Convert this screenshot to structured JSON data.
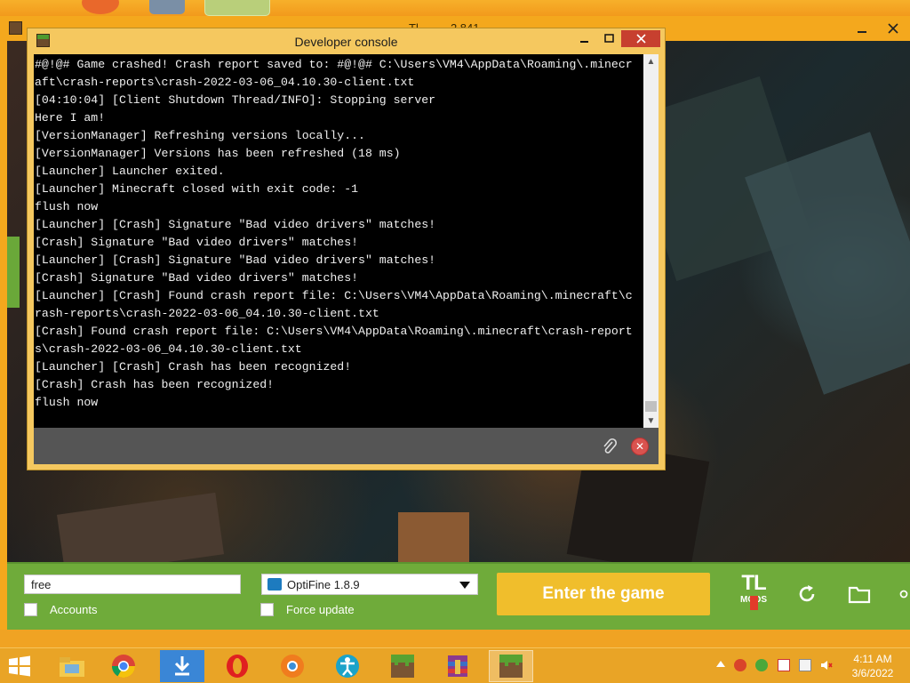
{
  "background_window": {
    "title": "Tl..........2.841"
  },
  "console": {
    "title": "Developer console",
    "lines": [
      "#@!@# Game crashed! Crash report saved to: #@!@# C:\\Users\\VM4\\AppData\\Roaming\\.minecr",
      "aft\\crash-reports\\crash-2022-03-06_04.10.30-client.txt",
      "[04:10:04] [Client Shutdown Thread/INFO]: Stopping server",
      "Here I am!",
      "[VersionManager] Refreshing versions locally...",
      "[VersionManager] Versions has been refreshed (18 ms)",
      "[Launcher] Launcher exited.",
      "[Launcher] Minecraft closed with exit code: -1",
      "flush now",
      "[Launcher] [Crash] Signature \"Bad video drivers\" matches!",
      "[Crash] Signature \"Bad video drivers\" matches!",
      "[Launcher] [Crash] Signature \"Bad video drivers\" matches!",
      "[Crash] Signature \"Bad video drivers\" matches!",
      "[Launcher] [Crash] Found crash report file: C:\\Users\\VM4\\AppData\\Roaming\\.minecraft\\c",
      "rash-reports\\crash-2022-03-06_04.10.30-client.txt",
      "[Crash] Found crash report file: C:\\Users\\VM4\\AppData\\Roaming\\.minecraft\\crash-report",
      "s\\crash-2022-03-06_04.10.30-client.txt",
      "[Launcher] [Crash] Crash has been recognized!",
      "[Crash] Crash has been recognized!",
      "flush now"
    ],
    "input_value": ""
  },
  "launcher_bar": {
    "username": "free",
    "accounts_label": "Accounts",
    "version_selected": "OptiFine 1.8.9",
    "force_update_label": "Force update",
    "enter_button": "Enter the game",
    "logo_top": "TL",
    "logo_bottom": "MODS"
  },
  "taskbar": {
    "time": "4:11 AM",
    "date": "3/6/2022",
    "apps": [
      "file-explorer",
      "chrome",
      "downloader",
      "opera",
      "browser-orange",
      "teamviewer-like",
      "minecraft",
      "winrar",
      "minecraft-launcher"
    ]
  },
  "colors": {
    "accent_orange": "#f4a81d",
    "bar_green": "#6fab3a",
    "enter_yellow": "#f0be2c",
    "console_frame": "#f5c85f",
    "close_red": "#c7402f"
  }
}
